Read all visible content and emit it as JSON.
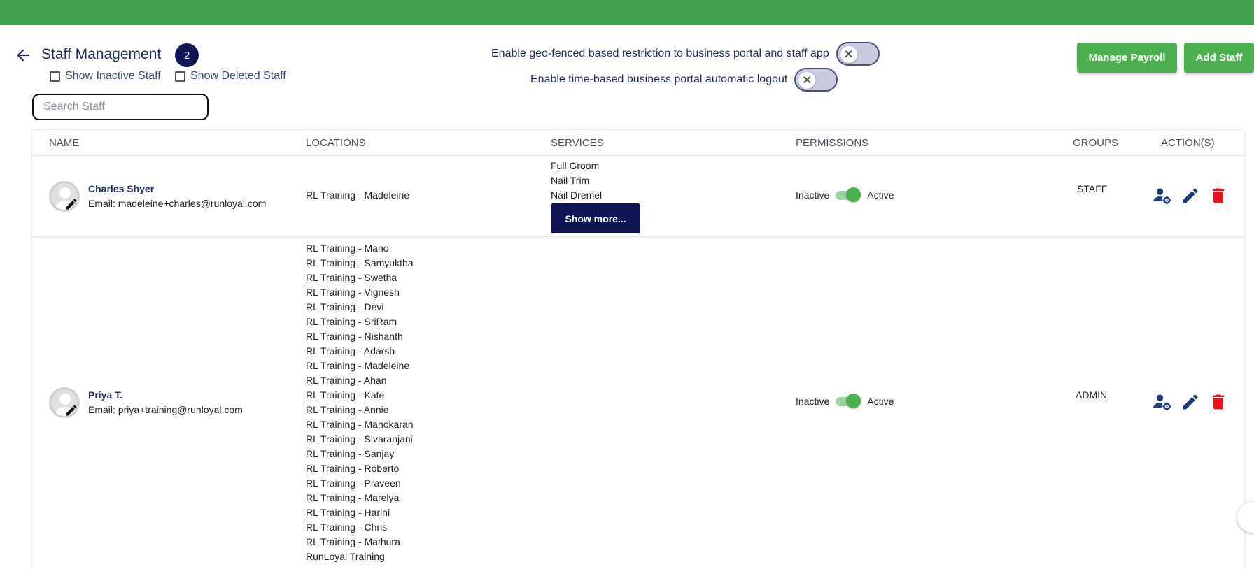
{
  "header": {
    "title": "Staff Management",
    "count": "2",
    "show_inactive_label": "Show Inactive Staff",
    "show_deleted_label": "Show Deleted Staff",
    "search_placeholder": "Search Staff",
    "geo_fence_label": "Enable geo-fenced based restriction to business portal and staff app",
    "auto_logout_label": "Enable time-based business portal automatic logout",
    "manage_payroll_label": "Manage Payroll",
    "add_staff_label": "Add Staff"
  },
  "table": {
    "columns": [
      "NAME",
      "LOCATIONS",
      "SERVICES",
      "PERMISSIONS",
      "GROUPS",
      "ACTION(S)"
    ],
    "rows": [
      {
        "name": "Charles Shyer",
        "email": "Email: madeleine+charles@runloyal.com",
        "locations": [
          "RL Training - Madeleine"
        ],
        "services": [
          "Full Groom",
          "Nail Trim",
          "Nail Dremel"
        ],
        "show_more_label": "Show more...",
        "perm_inactive": "Inactive",
        "perm_active": "Active",
        "permission_active": true,
        "group": "STAFF"
      },
      {
        "name": "Priya T.",
        "email": "Email: priya+training@runloyal.com",
        "locations": [
          "RL Training - Mano",
          "RL Training - Samyuktha",
          "RL Training - Swetha",
          "RL Training - Vignesh",
          "RL Training - Devi",
          "RL Training - SriRam",
          "RL Training - Nishanth",
          "RL Training - Adarsh",
          "RL Training - Madeleine",
          "RL Training - Ahan",
          "RL Training - Kate",
          "RL Training - Annie",
          "RL Training - Manokaran",
          "RL Training - Sivaranjani",
          "RL Training - Sanjay",
          "RL Training - Roberto",
          "RL Training - Praveen",
          "RL Training - Marelya",
          "RL Training - Harini",
          "RL Training - Chris",
          "RL Training - Mathura",
          "RunLoyal Training"
        ],
        "services": [],
        "perm_inactive": "Inactive",
        "perm_active": "Active",
        "permission_active": true,
        "group": "ADMIN"
      }
    ]
  },
  "colors": {
    "topbar": "#43a04c",
    "primary_navy": "#0f1653",
    "action_green": "#4caf50",
    "delete_red": "#e8131b"
  },
  "icons": [
    "back-arrow-icon",
    "close-icon",
    "user-settings-icon",
    "edit-pencil-icon",
    "delete-trash-icon",
    "avatar-edit-icon"
  ]
}
